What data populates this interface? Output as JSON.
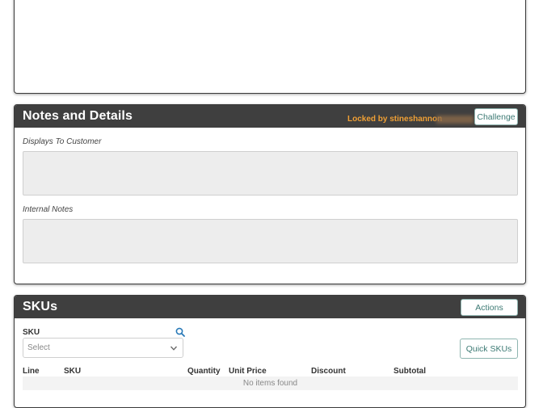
{
  "notes_section": {
    "title": "Notes and Details",
    "lock_text": "Locked by stineshannon",
    "challenge_label": "Challenge",
    "displays_to_customer_label": "Displays To Customer",
    "internal_notes_label": "Internal Notes"
  },
  "skus_section": {
    "title": "SKUs",
    "actions_label": "Actions",
    "sku_field_label": "SKU",
    "select_placeholder": "Select",
    "quick_skus_label": "Quick SKUs",
    "columns": [
      "Line",
      "SKU",
      "Quantity",
      "Unit Price",
      "Discount",
      "Subtotal"
    ],
    "empty_text": "No items found"
  },
  "colors": {
    "header_bg": "#3f3f3f",
    "lock_text": "#f0a035",
    "button_text": "#3d7a74",
    "search_icon": "#2a7ab8"
  },
  "icons": [
    "search-icon",
    "chevron-down-icon"
  ]
}
